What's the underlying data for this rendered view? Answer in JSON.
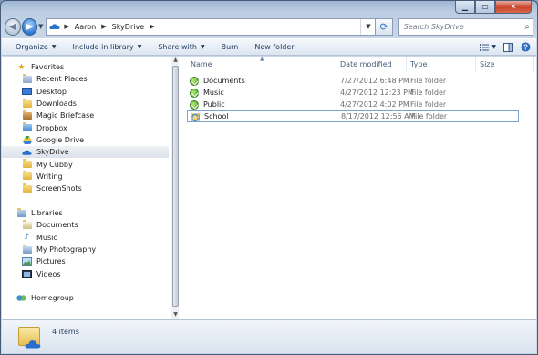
{
  "window": {
    "caption": {
      "minimize": "▁",
      "maximize": "▭",
      "close": "✕"
    }
  },
  "navbar": {
    "back_icon": "back-arrow-icon",
    "forward_icon": "forward-arrow-icon",
    "breadcrumbs": [
      "Aaron",
      "SkyDrive"
    ],
    "search_placeholder": "Search SkyDrive"
  },
  "toolbar": {
    "organize": "Organize",
    "include_in_library": "Include in library",
    "share_with": "Share with",
    "burn": "Burn",
    "new_folder": "New folder"
  },
  "sidebar": {
    "favorites": {
      "title": "Favorites",
      "items": [
        {
          "label": "Recent Places",
          "icon": "recent-places-icon"
        },
        {
          "label": "Desktop",
          "icon": "desktop-icon"
        },
        {
          "label": "Downloads",
          "icon": "downloads-icon"
        },
        {
          "label": "Magic Briefcase",
          "icon": "briefcase-icon"
        },
        {
          "label": "Dropbox",
          "icon": "dropbox-icon"
        },
        {
          "label": "Google Drive",
          "icon": "google-drive-icon"
        },
        {
          "label": "SkyDrive",
          "icon": "skydrive-cloud-icon",
          "selected": true
        },
        {
          "label": "My Cubby",
          "icon": "folder-icon"
        },
        {
          "label": "Writing",
          "icon": "folder-icon"
        },
        {
          "label": "ScreenShots",
          "icon": "folder-icon"
        }
      ]
    },
    "libraries": {
      "title": "Libraries",
      "items": [
        {
          "label": "Documents",
          "icon": "documents-icon"
        },
        {
          "label": "Music",
          "icon": "music-icon"
        },
        {
          "label": "My Photography",
          "icon": "photography-icon"
        },
        {
          "label": "Pictures",
          "icon": "pictures-icon"
        },
        {
          "label": "Videos",
          "icon": "videos-icon"
        }
      ]
    },
    "homegroup": {
      "title": "Homegroup"
    }
  },
  "filelist": {
    "columns": [
      "Name",
      "Date modified",
      "Type",
      "Size"
    ],
    "rows": [
      {
        "name": "Documents",
        "date": "7/27/2012 6:48 PM",
        "type": "File folder",
        "size": "",
        "status": "synced"
      },
      {
        "name": "Music",
        "date": "4/27/2012 12:23 PM",
        "type": "File folder",
        "size": "",
        "status": "synced"
      },
      {
        "name": "Public",
        "date": "4/27/2012 4:02 PM",
        "type": "File folder",
        "size": "",
        "status": "synced"
      },
      {
        "name": "School",
        "date": "8/17/2012 12:56 AM",
        "type": "File folder",
        "size": "",
        "status": "syncing"
      }
    ]
  },
  "details": {
    "item_count": "4 items"
  },
  "colors": {
    "accent": "#2e78cf",
    "selection_border": "#7da2ce",
    "folder": "#e6bf53"
  }
}
